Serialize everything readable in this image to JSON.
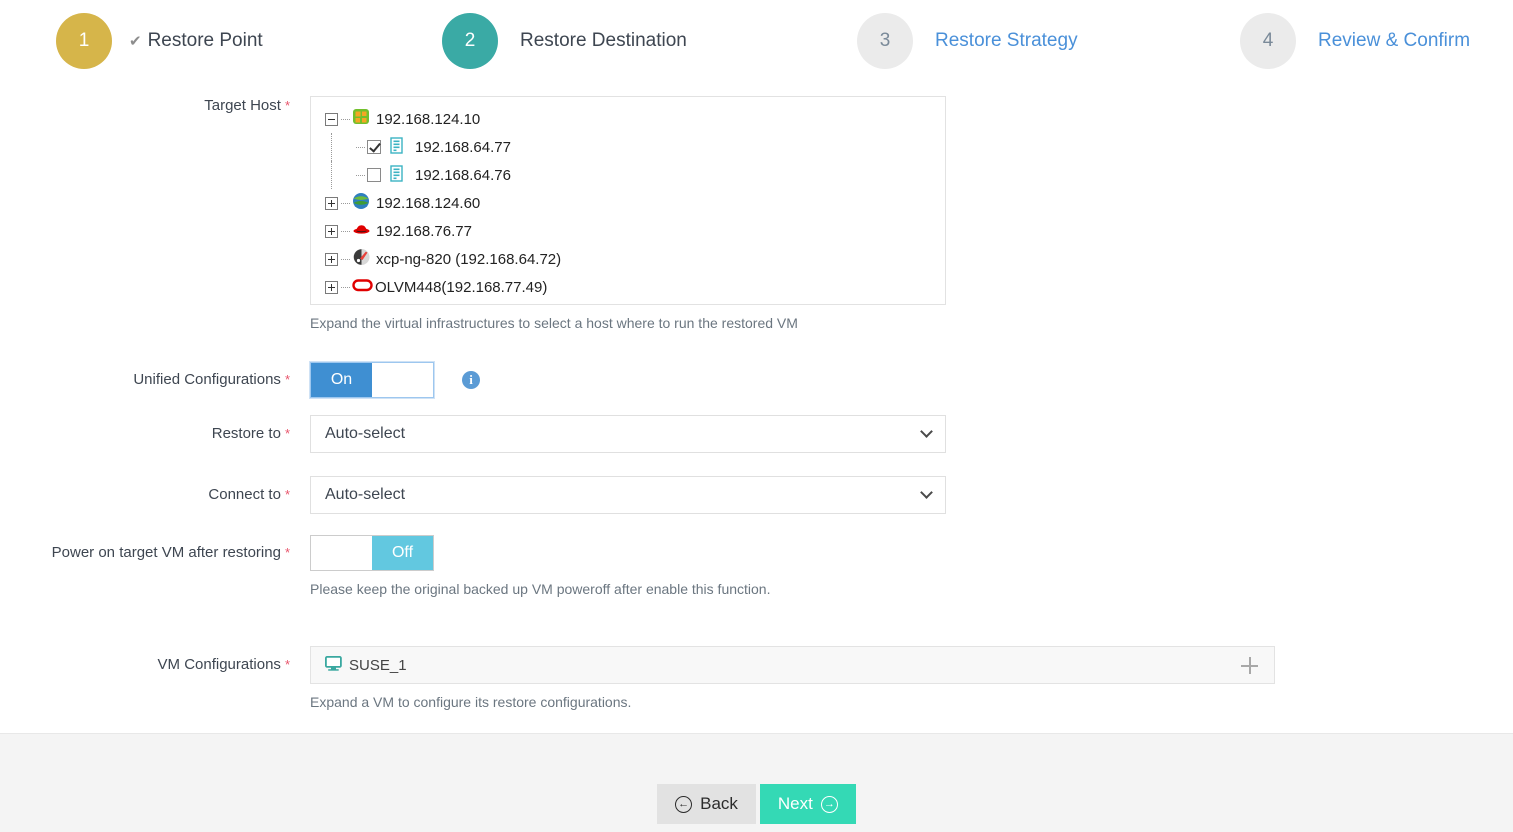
{
  "wizard": {
    "steps": [
      {
        "number": "1",
        "label": "Restore Point",
        "state": "done",
        "check": "✔"
      },
      {
        "number": "2",
        "label": "Restore Destination",
        "state": "active",
        "check": ""
      },
      {
        "number": "3",
        "label": "Restore Strategy",
        "state": "todo",
        "check": ""
      },
      {
        "number": "4",
        "label": "Review & Confirm",
        "state": "todo",
        "check": ""
      }
    ],
    "colors": {
      "done": "#d6b54a",
      "active": "#3aaaa5",
      "todo": "#ebebeb",
      "pending_text": "#4a90d9"
    }
  },
  "form": {
    "target_host": {
      "label": "Target Host",
      "required": "*",
      "helper": "Expand the virtual infrastructures to select a host where to run the restored VM",
      "tree": [
        {
          "label": "192.168.124.10",
          "expander": "minus",
          "icon": "vmware-cluster-icon",
          "level": 0,
          "checkbox": "none"
        },
        {
          "label": "192.168.64.77",
          "expander": "none",
          "icon": "esxi-host-icon",
          "level": 1,
          "checkbox": "checked"
        },
        {
          "label": "192.168.64.76",
          "expander": "none",
          "icon": "esxi-host-icon",
          "level": 1,
          "checkbox": "unchecked"
        },
        {
          "label": "192.168.124.60",
          "expander": "plus",
          "icon": "hyperv-globe-icon",
          "level": 0,
          "checkbox": "none"
        },
        {
          "label": "192.168.76.77",
          "expander": "plus",
          "icon": "redhat-icon",
          "level": 0,
          "checkbox": "none"
        },
        {
          "label": "xcp-ng-820 (192.168.64.72)",
          "expander": "plus",
          "icon": "xcp-ng-icon",
          "level": 0,
          "checkbox": "none"
        },
        {
          "label": "OLVM448(192.168.77.49)",
          "expander": "plus",
          "icon": "oracle-olvm-icon",
          "level": 0,
          "checkbox": "none"
        }
      ]
    },
    "unified_configurations": {
      "label": "Unified Configurations",
      "required": "*",
      "toggle_state": "On",
      "on_text": "On",
      "off_text": "",
      "info_glyph": "i"
    },
    "restore_to": {
      "label": "Restore to",
      "required": "*",
      "value": "Auto-select",
      "options": [
        "Auto-select"
      ]
    },
    "connect_to": {
      "label": "Connect to",
      "required": "*",
      "value": "Auto-select",
      "options": [
        "Auto-select"
      ]
    },
    "power_on": {
      "label": "Power on target VM after restoring",
      "required": "*",
      "toggle_state": "Off",
      "on_text": "",
      "off_text": "Off",
      "helper": "Please keep the original backed up VM poweroff after enable this function."
    },
    "vm_configurations": {
      "label": "VM Configurations",
      "required": "*",
      "helper": "Expand a VM to configure its restore configurations.",
      "items": [
        {
          "name": "SUSE_1",
          "icon": "monitor-icon",
          "expand": "+"
        }
      ]
    }
  },
  "footer": {
    "back_label": "Back",
    "back_icon": "←",
    "next_label": "Next",
    "next_icon": "→"
  }
}
